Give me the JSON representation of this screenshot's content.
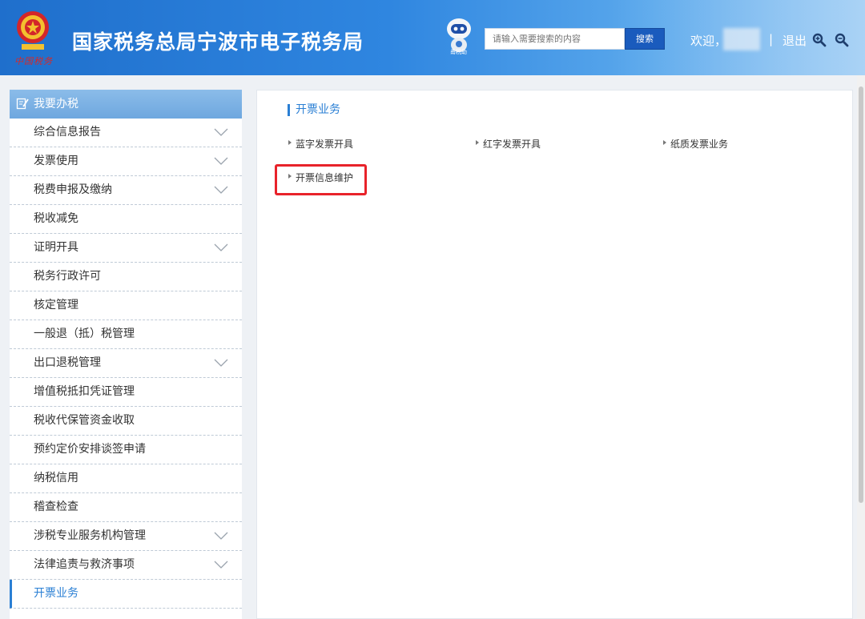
{
  "header": {
    "title": "国家税务总局宁波市电子税务局",
    "signature": "中国税务",
    "robot_label": "甬税助",
    "search_placeholder": "请输入需要搜索的内容",
    "search_button": "搜索",
    "welcome": "欢迎，",
    "separator": "|",
    "logout": "退出"
  },
  "sidebar": {
    "title": "我要办税",
    "items": [
      {
        "label": "综合信息报告",
        "expandable": true
      },
      {
        "label": "发票使用",
        "expandable": true
      },
      {
        "label": "税费申报及缴纳",
        "expandable": true
      },
      {
        "label": "税收减免",
        "expandable": false
      },
      {
        "label": "证明开具",
        "expandable": true
      },
      {
        "label": "税务行政许可",
        "expandable": false
      },
      {
        "label": "核定管理",
        "expandable": false
      },
      {
        "label": "一般退（抵）税管理",
        "expandable": false
      },
      {
        "label": "出口退税管理",
        "expandable": true
      },
      {
        "label": "增值税抵扣凭证管理",
        "expandable": false
      },
      {
        "label": "税收代保管资金收取",
        "expandable": false
      },
      {
        "label": "预约定价安排谈签申请",
        "expandable": false
      },
      {
        "label": "纳税信用",
        "expandable": false
      },
      {
        "label": "稽查检查",
        "expandable": false
      },
      {
        "label": "涉税专业服务机构管理",
        "expandable": true
      },
      {
        "label": "法律追责与救济事项",
        "expandable": true
      },
      {
        "label": "开票业务",
        "expandable": false,
        "active": true
      }
    ]
  },
  "main": {
    "section_title": "开票业务",
    "links": [
      {
        "label": "蓝字发票开具"
      },
      {
        "label": "红字发票开具"
      },
      {
        "label": "纸质发票业务"
      },
      {
        "label": "开票信息维护"
      }
    ]
  },
  "colors": {
    "header_blue": "#1f6fcc",
    "accent": "#2a7fd4",
    "highlight_red": "#e8222a"
  }
}
